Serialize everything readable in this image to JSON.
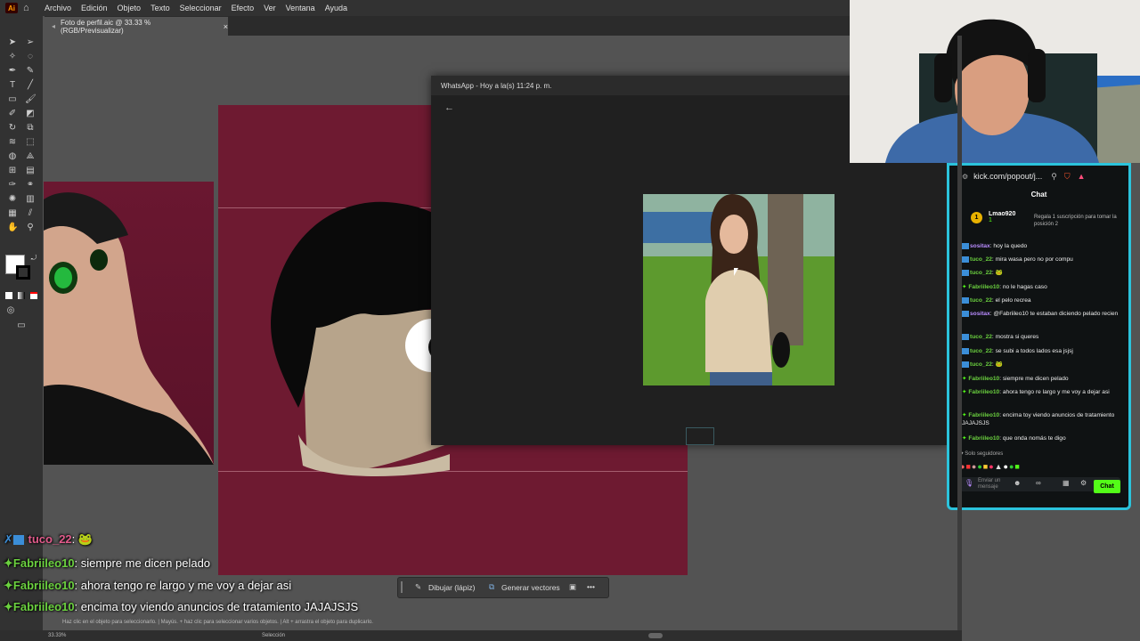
{
  "menubar": {
    "logo": "Ai",
    "items": [
      "Archivo",
      "Edición",
      "Objeto",
      "Texto",
      "Seleccionar",
      "Efecto",
      "Ver",
      "Ventana",
      "Ayuda"
    ]
  },
  "document_tab": {
    "label": "Foto de perfil.aic @ 33.33 % (RGB/Previsualizar)",
    "close": "×"
  },
  "whatsapp": {
    "title": "WhatsApp - Hoy a la(s) 11:24 p. m.",
    "back": "←"
  },
  "kick": {
    "url": "kick.com/popout/j...",
    "chat_title": "Chat",
    "top_user": "Lmao920",
    "top_count": "1",
    "promo": "Regala 1 suscripción para tomar la posición 2",
    "messages": [
      {
        "user": "sositax",
        "text": "hoy la quedo",
        "color": "#b98cff"
      },
      {
        "user": "tuco_22",
        "text": "mira wasa pero no por compu",
        "color": "#6bd13f"
      },
      {
        "user": "tuco_22",
        "text": "",
        "color": "#6bd13f"
      },
      {
        "user": "Fabriileo10",
        "text": "no le hagas caso",
        "color": "#6bd13f"
      },
      {
        "user": "tuco_22",
        "text": "el pelo recrea",
        "color": "#6bd13f"
      },
      {
        "user": "sositax",
        "text": "@Fabriileo10 te estaban diciendo pelado recien",
        "color": "#b98cff"
      },
      {
        "user": "tuco_22",
        "text": "mostra si queres",
        "color": "#6bd13f"
      },
      {
        "user": "tuco_22",
        "text": "se subi a todos lados esa jsjsj",
        "color": "#6bd13f"
      },
      {
        "user": "tuco_22",
        "text": "",
        "color": "#6bd13f"
      },
      {
        "user": "Fabriileo10",
        "text": "siempre me dicen pelado",
        "color": "#6bd13f"
      },
      {
        "user": "Fabriileo10",
        "text": "ahora tengo re largo y me voy a dejar asi",
        "color": "#6bd13f"
      },
      {
        "user": "Fabriileo10",
        "text": "encima toy viendo anuncios de tratamiento JAJAJSJS",
        "color": "#6bd13f"
      },
      {
        "user": "Fabriileo10",
        "text": "que onda nomás te digo",
        "color": "#6bd13f"
      }
    ],
    "only_followers": "Solo seguidores",
    "input_placeholder": "Enviar un mensaje",
    "chat_button": "Chat"
  },
  "overlay_chat": [
    {
      "user": "tuco_22",
      "text": ""
    },
    {
      "user": "Fabriileo10",
      "text": "siempre me dicen pelado"
    },
    {
      "user": "Fabriileo10",
      "text": "ahora tengo re largo y me voy a dejar asi"
    },
    {
      "user": "Fabriileo10",
      "text": "encima toy viendo anuncios de tratamiento JAJAJSJS"
    },
    {
      "user": "Fabriileo10",
      "text": "que onda nomás te digo"
    }
  ],
  "context_toolbar": {
    "draw_label": "Dibujar (lápiz)",
    "vectorize_label": "Generar vectores",
    "more": "•••"
  },
  "status": {
    "hint": "Haz clic en el objeto para seleccionarlo. | Mayús. + haz clic para seleccionar varios objetos. | Alt + arrastra el objeto para duplicarlo.",
    "zoom": "33.33%",
    "mode": "Selección"
  }
}
